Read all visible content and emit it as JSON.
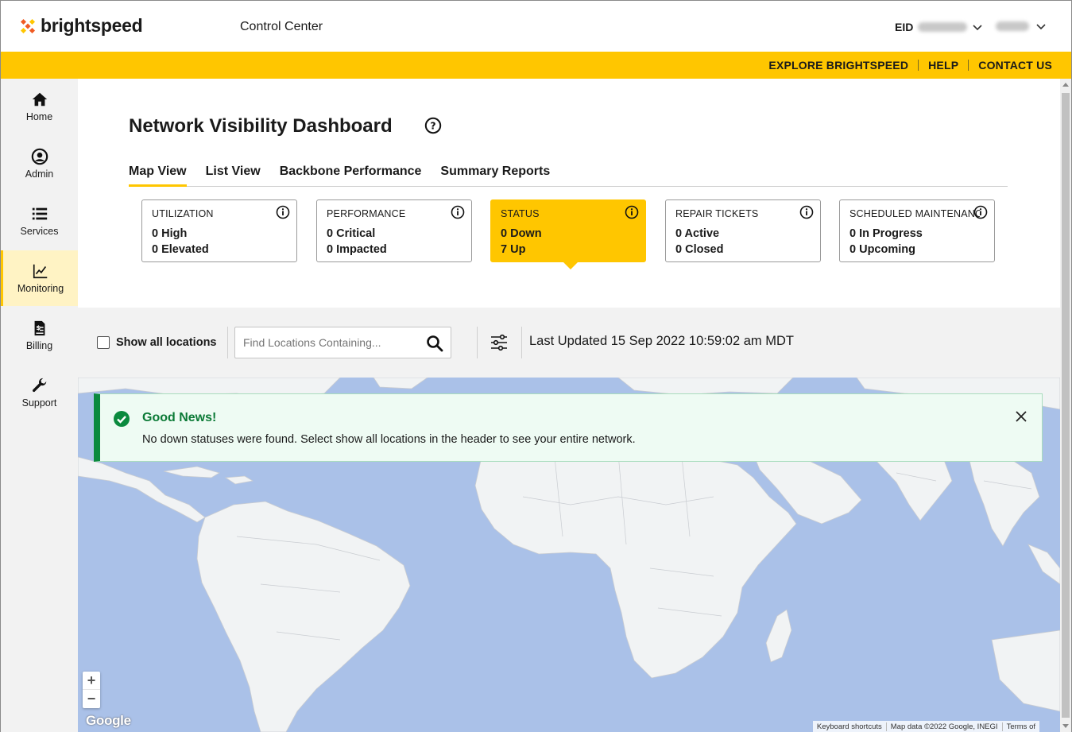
{
  "brand": {
    "name": "brightspeed",
    "accent": "#FFC600",
    "orange": "#F05A22"
  },
  "header": {
    "app_title": "Control Center",
    "eid_label": "EID"
  },
  "top_links": [
    "EXPLORE BRIGHTSPEED",
    "HELP",
    "CONTACT US"
  ],
  "sidebar": {
    "items": [
      {
        "label": "Home",
        "icon": "home-icon",
        "active": false
      },
      {
        "label": "Admin",
        "icon": "user-circle-icon",
        "active": false
      },
      {
        "label": "Services",
        "icon": "list-icon",
        "active": false
      },
      {
        "label": "Monitoring",
        "icon": "chart-line-icon",
        "active": true
      },
      {
        "label": "Billing",
        "icon": "invoice-icon",
        "active": false
      },
      {
        "label": "Support",
        "icon": "wrench-icon",
        "active": false
      }
    ]
  },
  "page": {
    "title": "Network Visibility Dashboard",
    "tabs": [
      {
        "label": "Map View",
        "active": true
      },
      {
        "label": "List View",
        "active": false
      },
      {
        "label": "Backbone Performance",
        "active": false
      },
      {
        "label": "Summary Reports",
        "active": false
      }
    ],
    "cards": [
      {
        "title": "UTILIZATION",
        "line1": "0 High",
        "line2": "0 Elevated",
        "active": false
      },
      {
        "title": "PERFORMANCE",
        "line1": "0 Critical",
        "line2": "0 Impacted",
        "active": false
      },
      {
        "title": "STATUS",
        "line1": "0 Down",
        "line2": "7 Up",
        "active": true
      },
      {
        "title": "REPAIR TICKETS",
        "line1": "0 Active",
        "line2": "0 Closed",
        "active": false
      },
      {
        "title": "SCHEDULED MAINTENANCE",
        "line1": "0 In Progress",
        "line2": "0 Upcoming",
        "active": false
      }
    ]
  },
  "filters": {
    "show_all_label": "Show all locations",
    "show_all_checked": false,
    "search_placeholder": "Find Locations Containing...",
    "last_updated": "Last Updated 15 Sep 2022 10:59:02 am MDT"
  },
  "toast": {
    "title": "Good News!",
    "message": "No down statuses were found. Select show all locations in the header to see your entire network."
  },
  "map": {
    "zoom_in": "+",
    "zoom_out": "−",
    "google": "Google",
    "attribution": [
      "Keyboard shortcuts",
      "Map data ©2022 Google, INEGI",
      "Terms of"
    ]
  }
}
